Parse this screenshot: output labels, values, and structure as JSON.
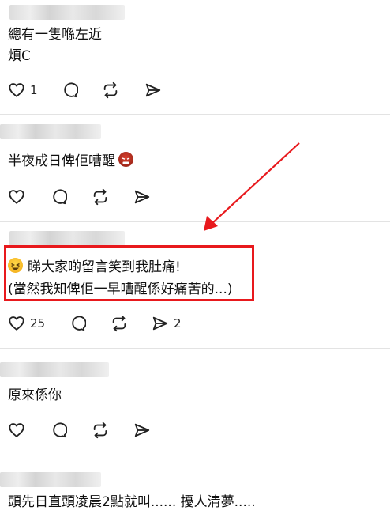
{
  "comments": [
    {
      "id": "c1",
      "lines": [
        "總有一隻喺左近",
        "煩C"
      ],
      "likes": "1",
      "reposts": ""
    },
    {
      "id": "c2",
      "lines": [
        "半夜成日俾佢嘈醒"
      ],
      "likes": "",
      "reposts": ""
    },
    {
      "id": "c3",
      "lines": [
        "睇大家啲留言笑到我肚痛!",
        "(當然我知俾佢一早嘈醒係好痛苦的...)"
      ],
      "likes": "25",
      "reposts": "2"
    },
    {
      "id": "c4",
      "lines": [
        "原來係你"
      ],
      "likes": "",
      "reposts": ""
    },
    {
      "id": "c5",
      "lines": [
        "頭先日直頭凌晨2點就叫...... 擾人清夢....."
      ],
      "likes": "",
      "reposts": ""
    }
  ],
  "icons": {
    "like": "heart-icon",
    "reply": "comment-icon",
    "repost": "repost-icon",
    "share": "send-icon"
  },
  "colors": {
    "highlight": "#e8191d",
    "arrow": "#e8191d",
    "icon": "#222222"
  }
}
